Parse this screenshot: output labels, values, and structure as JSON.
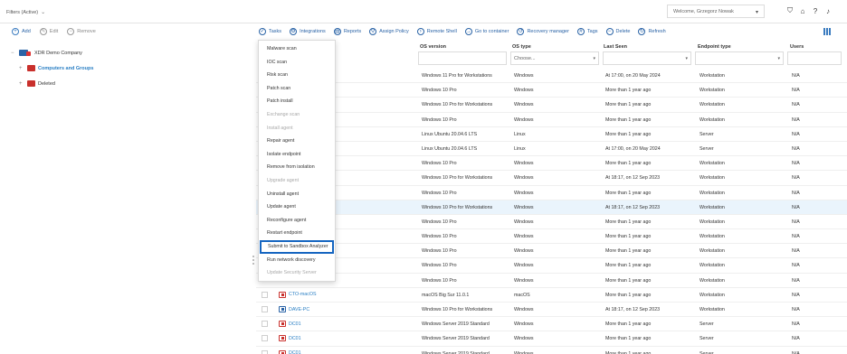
{
  "topbar": {
    "filters_label": "Filters (Active)",
    "welcome": "Welcome, Grzegorz Nowak"
  },
  "left_toolbar": {
    "add": "Add",
    "edit": "Edit",
    "remove": "Remove"
  },
  "tree": {
    "root": "XDR Demo Company",
    "children": [
      "Computers and Groups",
      "Deleted"
    ]
  },
  "right_toolbar": [
    "Tasks",
    "Integrations",
    "Reports",
    "Assign Policy",
    "Remote Shell",
    "Go to container",
    "Recovery manager",
    "Tags",
    "Delete",
    "Refresh"
  ],
  "grid": {
    "columns": [
      "OS version",
      "OS type",
      "Last Seen",
      "Endpoint type",
      "Users"
    ],
    "os_type_filter": "Choose...",
    "rows": [
      {
        "name": "",
        "os_version": "Windows 11 Pro for Workstations",
        "os_type": "Windows",
        "last_seen": "At 17:00, on 20 May 2024",
        "endpoint_type": "Workstation",
        "users": "N/A"
      },
      {
        "name": "",
        "os_version": "Windows 10 Pro",
        "os_type": "Windows",
        "last_seen": "More than 1 year ago",
        "endpoint_type": "Workstation",
        "users": "N/A"
      },
      {
        "name": "",
        "os_version": "Windows 10 Pro for Workstations",
        "os_type": "Windows",
        "last_seen": "More than 1 year ago",
        "endpoint_type": "Workstation",
        "users": "N/A"
      },
      {
        "name": "",
        "os_version": "Windows 10 Pro",
        "os_type": "Windows",
        "last_seen": "More than 1 year ago",
        "endpoint_type": "Workstation",
        "users": "N/A"
      },
      {
        "name": "",
        "os_version": "Linux Ubuntu 20.04.6 LTS",
        "os_type": "Linux",
        "last_seen": "More than 1 year ago",
        "endpoint_type": "Server",
        "users": "N/A"
      },
      {
        "name": "",
        "os_version": "Linux Ubuntu 20.04.6 LTS",
        "os_type": "Linux",
        "last_seen": "At 17:00, on 20 May 2024",
        "endpoint_type": "Server",
        "users": "N/A"
      },
      {
        "name": "",
        "os_version": "Windows 10 Pro",
        "os_type": "Windows",
        "last_seen": "More than 1 year ago",
        "endpoint_type": "Workstation",
        "users": "N/A"
      },
      {
        "name": "",
        "os_version": "Windows 10 Pro for Workstations",
        "os_type": "Windows",
        "last_seen": "At 18:17, on 12 Sep 2023",
        "endpoint_type": "Workstation",
        "users": "N/A"
      },
      {
        "name": "",
        "os_version": "Windows 10 Pro",
        "os_type": "Windows",
        "last_seen": "More than 1 year ago",
        "endpoint_type": "Workstation",
        "users": "N/A"
      },
      {
        "name": "",
        "os_version": "Windows 10 Pro for Workstations",
        "os_type": "Windows",
        "last_seen": "At 18:17, on 12 Sep 2023",
        "endpoint_type": "Workstation",
        "users": "N/A"
      },
      {
        "name": "",
        "os_version": "Windows 10 Pro",
        "os_type": "Windows",
        "last_seen": "More than 1 year ago",
        "endpoint_type": "Workstation",
        "users": "N/A"
      },
      {
        "name": "",
        "os_version": "Windows 10 Pro",
        "os_type": "Windows",
        "last_seen": "More than 1 year ago",
        "endpoint_type": "Workstation",
        "users": "N/A"
      },
      {
        "name": "",
        "os_version": "Windows 10 Pro",
        "os_type": "Windows",
        "last_seen": "More than 1 year ago",
        "endpoint_type": "Workstation",
        "users": "N/A"
      },
      {
        "name": "",
        "os_version": "Windows 10 Pro",
        "os_type": "Windows",
        "last_seen": "More than 1 year ago",
        "endpoint_type": "Workstation",
        "users": "N/A"
      },
      {
        "name": "",
        "os_version": "Windows 10 Pro",
        "os_type": "Windows",
        "last_seen": "More than 1 year ago",
        "endpoint_type": "Workstation",
        "users": "N/A"
      },
      {
        "name": "CTO-macOS",
        "os_version": "macOS Big Sur 11.0.1",
        "os_type": "macOS",
        "last_seen": "More than 1 year ago",
        "endpoint_type": "Workstation",
        "users": "N/A"
      },
      {
        "name": "DAVE-PC",
        "os_version": "Windows 10 Pro for Workstations",
        "os_type": "Windows",
        "last_seen": "At 18:17, on 12 Sep 2023",
        "endpoint_type": "Workstation",
        "users": "N/A"
      },
      {
        "name": "DC01",
        "os_version": "Windows Server 2019 Standard",
        "os_type": "Windows",
        "last_seen": "More than 1 year ago",
        "endpoint_type": "Server",
        "users": "N/A"
      },
      {
        "name": "DC01",
        "os_version": "Windows Server 2019 Standard",
        "os_type": "Windows",
        "last_seen": "More than 1 year ago",
        "endpoint_type": "Server",
        "users": "N/A"
      },
      {
        "name": "DC01",
        "os_version": "Windows Server 2019 Standard",
        "os_type": "Windows",
        "last_seen": "More than 1 year ago",
        "endpoint_type": "Server",
        "users": "N/A"
      }
    ]
  },
  "menu": {
    "items": [
      {
        "label": "Malware scan",
        "disabled": false
      },
      {
        "label": "IOC scan",
        "disabled": false
      },
      {
        "label": "Risk scan",
        "disabled": false
      },
      {
        "label": "Patch scan",
        "disabled": false
      },
      {
        "label": "Patch install",
        "disabled": false
      },
      {
        "label": "Exchange scan",
        "disabled": true
      },
      {
        "label": "Install agent",
        "disabled": true
      },
      {
        "label": "Repair agent",
        "disabled": false
      },
      {
        "label": "Isolate endpoint",
        "disabled": false
      },
      {
        "label": "Remove from isolation",
        "disabled": false
      },
      {
        "label": "Upgrade agent",
        "disabled": true
      },
      {
        "label": "Uninstall agent",
        "disabled": false
      },
      {
        "label": "Update agent",
        "disabled": false
      },
      {
        "label": "Reconfigure agent",
        "disabled": false
      },
      {
        "label": "Restart endpoint",
        "disabled": false
      },
      {
        "label": "Submit to Sandbox Analyzer",
        "disabled": false,
        "selected": true
      },
      {
        "label": "Run network discovery",
        "disabled": false
      },
      {
        "label": "Update Security Server",
        "disabled": true
      }
    ]
  },
  "colors": {
    "accent": "#2a63a6",
    "link": "#2a7fc4",
    "selection_outline": "#1565c0",
    "highlight_row": "#eaf4fc"
  }
}
